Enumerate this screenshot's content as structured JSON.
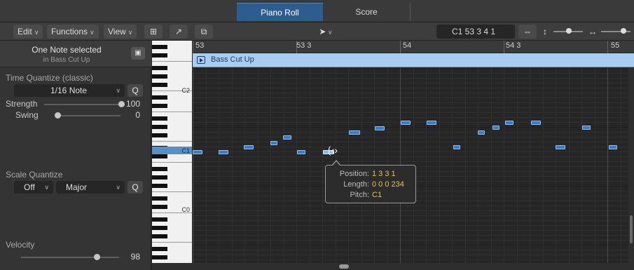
{
  "tabs": [
    {
      "label": "Piano Roll",
      "active": true
    },
    {
      "label": "Score",
      "active": false
    }
  ],
  "toolbar": {
    "edit_label": "Edit",
    "functions_label": "Functions",
    "view_label": "View",
    "position_display": "C1  53 3 4 1"
  },
  "inspector": {
    "selection_title": "One Note selected",
    "selection_sub": "in Bass Cut Up",
    "time_quantize_label": "Time Quantize (classic)",
    "time_quantize_value": "1/16 Note",
    "q_label": "Q",
    "strength_label": "Strength",
    "strength_value": "100",
    "strength_level": 1.0,
    "swing_label": "Swing",
    "swing_value": "0",
    "swing_level": 0.0,
    "scale_quantize_label": "Scale Quantize",
    "scale_root": "Off",
    "scale_type": "Major",
    "velocity_label": "Velocity",
    "velocity_value": "98",
    "velocity_level": 0.77
  },
  "keyboard": {
    "c_labels": [
      "C2",
      "C1",
      "C0"
    ]
  },
  "ruler": {
    "labels": [
      "53",
      "53 3",
      "54",
      "54 3",
      "55"
    ]
  },
  "region": {
    "name": "Bass Cut Up"
  },
  "tooltip": {
    "position_label": "Position:",
    "position_value": "1 3 3 1",
    "length_label": "Length:",
    "length_value": "0 0 0 234",
    "pitch_label": "Pitch:",
    "pitch_value": "C1"
  },
  "icons": {
    "chevron": "chevron-down-icon",
    "pointer": "arrow-pointer-icon"
  },
  "colors": {
    "accent": "#2d5d8f",
    "region": "#a8cdf0",
    "note": "#3c7bc4",
    "tooltip_value": "#e3c35a"
  }
}
